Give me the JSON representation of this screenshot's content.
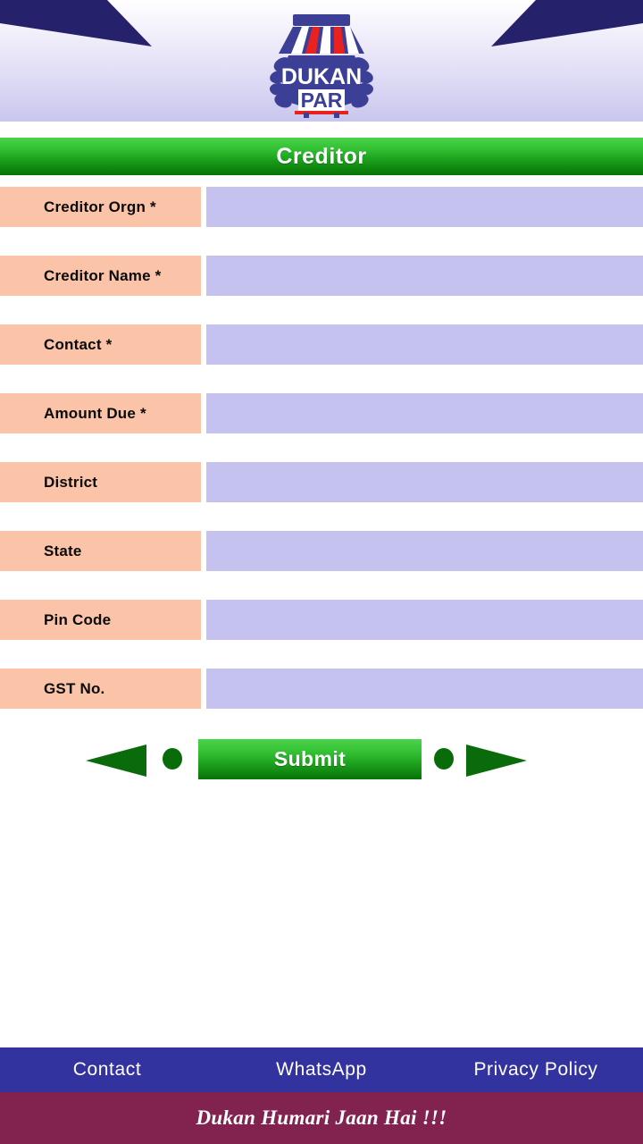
{
  "header": {
    "logo": {
      "brand_top": "DUKAN",
      "brand_bottom": "PAR",
      "awning_stripe_colors": [
        "#3b3f96",
        "#ffffff",
        "#e8231f"
      ],
      "badge_color": "#3b3f96",
      "wing_color": "#25226b"
    }
  },
  "page": {
    "title": "Creditor",
    "title_bar_color_top": "#4ad34a",
    "title_bar_color_bottom": "#057405"
  },
  "form": {
    "label_bg": "#fbc3a7",
    "input_bg": "#c5c2f0",
    "fields": [
      {
        "label": "Creditor Orgn *",
        "value": "",
        "placeholder": ""
      },
      {
        "label": "Creditor Name *",
        "value": "",
        "placeholder": ""
      },
      {
        "label": "Contact *",
        "value": "",
        "placeholder": ""
      },
      {
        "label": "Amount Due *",
        "value": "",
        "placeholder": ""
      },
      {
        "label": "District",
        "value": "",
        "placeholder": ""
      },
      {
        "label": "State",
        "value": "",
        "placeholder": ""
      },
      {
        "label": "Pin Code",
        "value": "",
        "placeholder": ""
      },
      {
        "label": "GST No.",
        "value": "",
        "placeholder": ""
      }
    ]
  },
  "actions": {
    "prev_icon": "triangle-left-icon",
    "prev_dot_icon": "circle-icon",
    "submit_label": "Submit",
    "next_dot_icon": "circle-icon",
    "next_icon": "triangle-right-icon",
    "arrow_color": "#0a6b0a"
  },
  "footer": {
    "nav_bg": "#33339f",
    "items": [
      {
        "label": "Contact"
      },
      {
        "label": "WhatsApp"
      },
      {
        "label": "Privacy Policy"
      }
    ],
    "tagline": "Dukan Humari Jaan Hai !!!",
    "tagline_bg": "#82234f"
  }
}
